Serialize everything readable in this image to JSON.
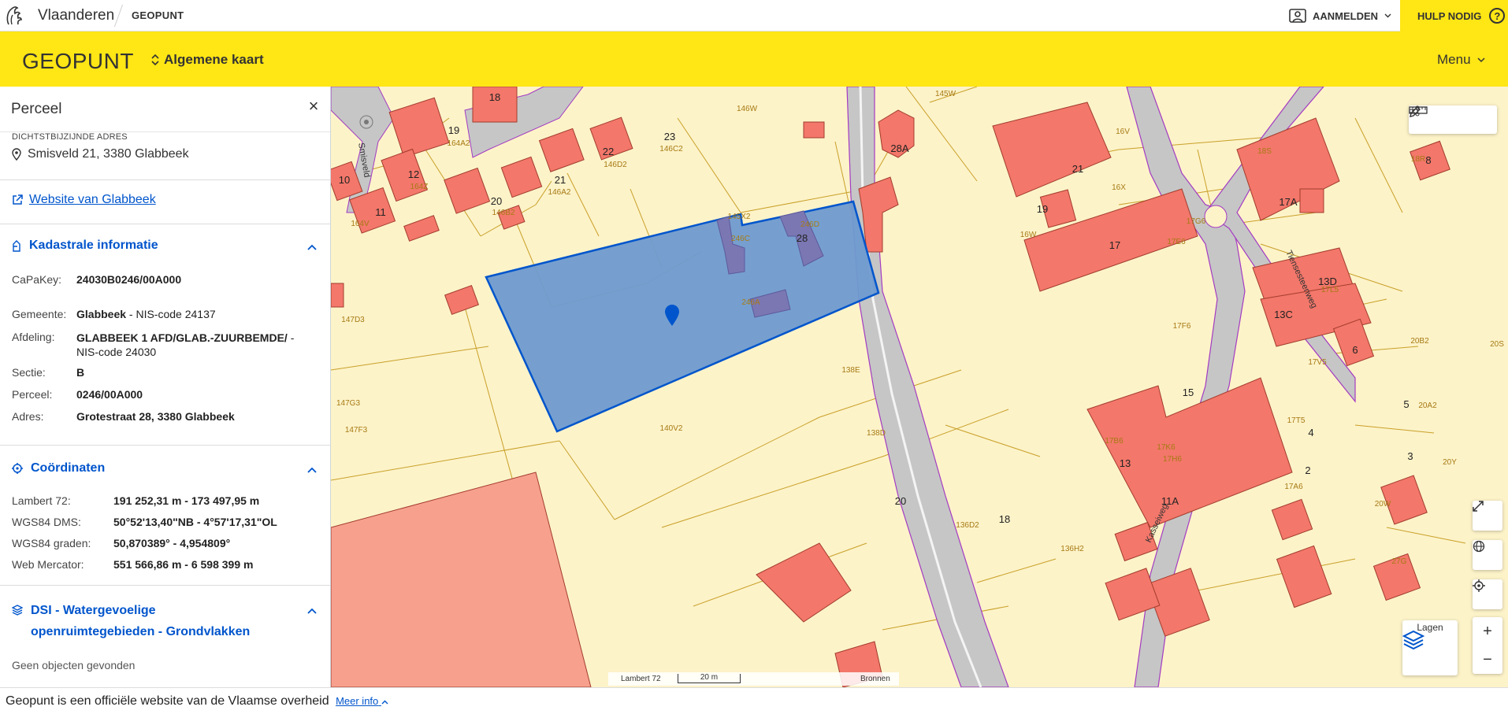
{
  "topbar": {
    "brand": "Vlaanderen",
    "app": "GEOPUNT",
    "login": "AANMELDEN",
    "help": "HULP NODIG"
  },
  "header": {
    "title": "GEOPUNT",
    "map_selector": "Algemene kaart",
    "menu": "Menu"
  },
  "panel": {
    "title": "Perceel",
    "address_label": "DICHTSTBIJZIJNDE ADRES",
    "address": "Smisveld 21, 3380 Glabbeek",
    "website_link": "Website van Glabbeek",
    "kadaster": {
      "title": "Kadastrale informatie",
      "capakey_label": "CaPaKey:",
      "capakey": "24030B0246/00A000",
      "gemeente_label": "Gemeente:",
      "gemeente": "Glabbeek",
      "gemeente_nis": " - NIS-code 24137",
      "afdeling_label": "Afdeling:",
      "afdeling_line1": "GLABBEEK 1 AFD/GLAB.-ZUURBEMDE/",
      "afdeling_line1_suffix": " -",
      "afdeling_line2": "NIS-code 24030",
      "sectie_label": "Sectie:",
      "sectie": "B",
      "perceel_label": "Perceel:",
      "perceel": "0246/00A000",
      "adres_label": "Adres:",
      "adres": "Grotestraat 28, 3380 Glabbeek"
    },
    "coords": {
      "title": "Coördinaten",
      "lambert_label": "Lambert 72:",
      "lambert": "191 252,31 m - 173 497,95 m",
      "dms_label": "WGS84 DMS:",
      "dms": "50°52'13,40\"NB - 4°57'17,31\"OL",
      "deg_label": "WGS84 graden:",
      "deg": "50,870389° - 4,954809°",
      "merc_label": "Web Mercator:",
      "merc": "551 566,86 m - 6 598 399 m"
    },
    "dsi": {
      "title_line1": "DSI - Watergevoelige",
      "title_line2": "openruimtegebieden - Grondvlakken",
      "empty": "Geen objecten gevonden"
    }
  },
  "map": {
    "labels": {
      "b18": "18",
      "b19": "19",
      "b12": "12",
      "b10": "10",
      "b11": "11",
      "b20": "20",
      "b21": "21",
      "b22": "22",
      "b23": "23",
      "b28a": "28A",
      "b21r": "21",
      "b19r": "19",
      "b17": "17",
      "b17a": "17A",
      "b8": "8",
      "b13d": "13D",
      "b13c": "13C",
      "b6": "6",
      "b15": "15",
      "b13": "13",
      "b4": "4",
      "b5": "5",
      "b2": "2",
      "b3": "3",
      "b11a": "11A",
      "b18b": "18",
      "b20b": "20",
      "b28": "28",
      "p146w": "146W",
      "p145w": "145W",
      "p16v": "16V",
      "p18s": "18S",
      "p18r": "18R",
      "p164a2": "164A2",
      "p164z": "164Z",
      "p146c2": "146C2",
      "p146d2": "146D2",
      "p146a2": "146A2",
      "p146b2": "146B2",
      "p164v": "164V",
      "p145x2": "145X2",
      "p246c": "246C",
      "p246d": "246D",
      "p16x": "16X",
      "p16w": "16W",
      "p17g6": "17G6",
      "p17e6": "17E6",
      "p17l5": "17L5",
      "p17f6": "17F6",
      "p246a": "246A",
      "p147d3": "147D3",
      "p138e": "138E",
      "p20b2": "20B2",
      "p17v5": "17V5",
      "p20a2": "20A2",
      "p147g3": "147G3",
      "p147f3": "147F3",
      "p140v2": "140V2",
      "p138d": "138D",
      "p17t5": "17T5",
      "p17b6": "17B6",
      "p17k6": "17K6",
      "p17h6": "17H6",
      "p20y": "20Y",
      "p17a6": "17A6",
      "p20w": "20W",
      "p136d2": "136D2",
      "p136h2": "136H2",
      "p27g": "27G",
      "p20s": "20S",
      "s_smisveld": "Smisveld",
      "s_tienen": "Tiensesteenweg",
      "s_kassei": "Kasseiweg"
    },
    "scale": {
      "crs": "Lambert 72",
      "distance": "20 m",
      "sources": "Bronnen"
    },
    "layers_button": "Lagen",
    "colors": {
      "parcel_fill": "#fdf3c9",
      "parcel_line": "#c8a028",
      "building": "#f3776a",
      "selection": "#6f9ad0",
      "selection_line": "#0055cc",
      "road": "#c6c6c6",
      "road_edge": "#a43bc2"
    }
  },
  "footer": {
    "text": "Geopunt is een officiële website van de Vlaamse overheid",
    "more": "Meer info"
  }
}
